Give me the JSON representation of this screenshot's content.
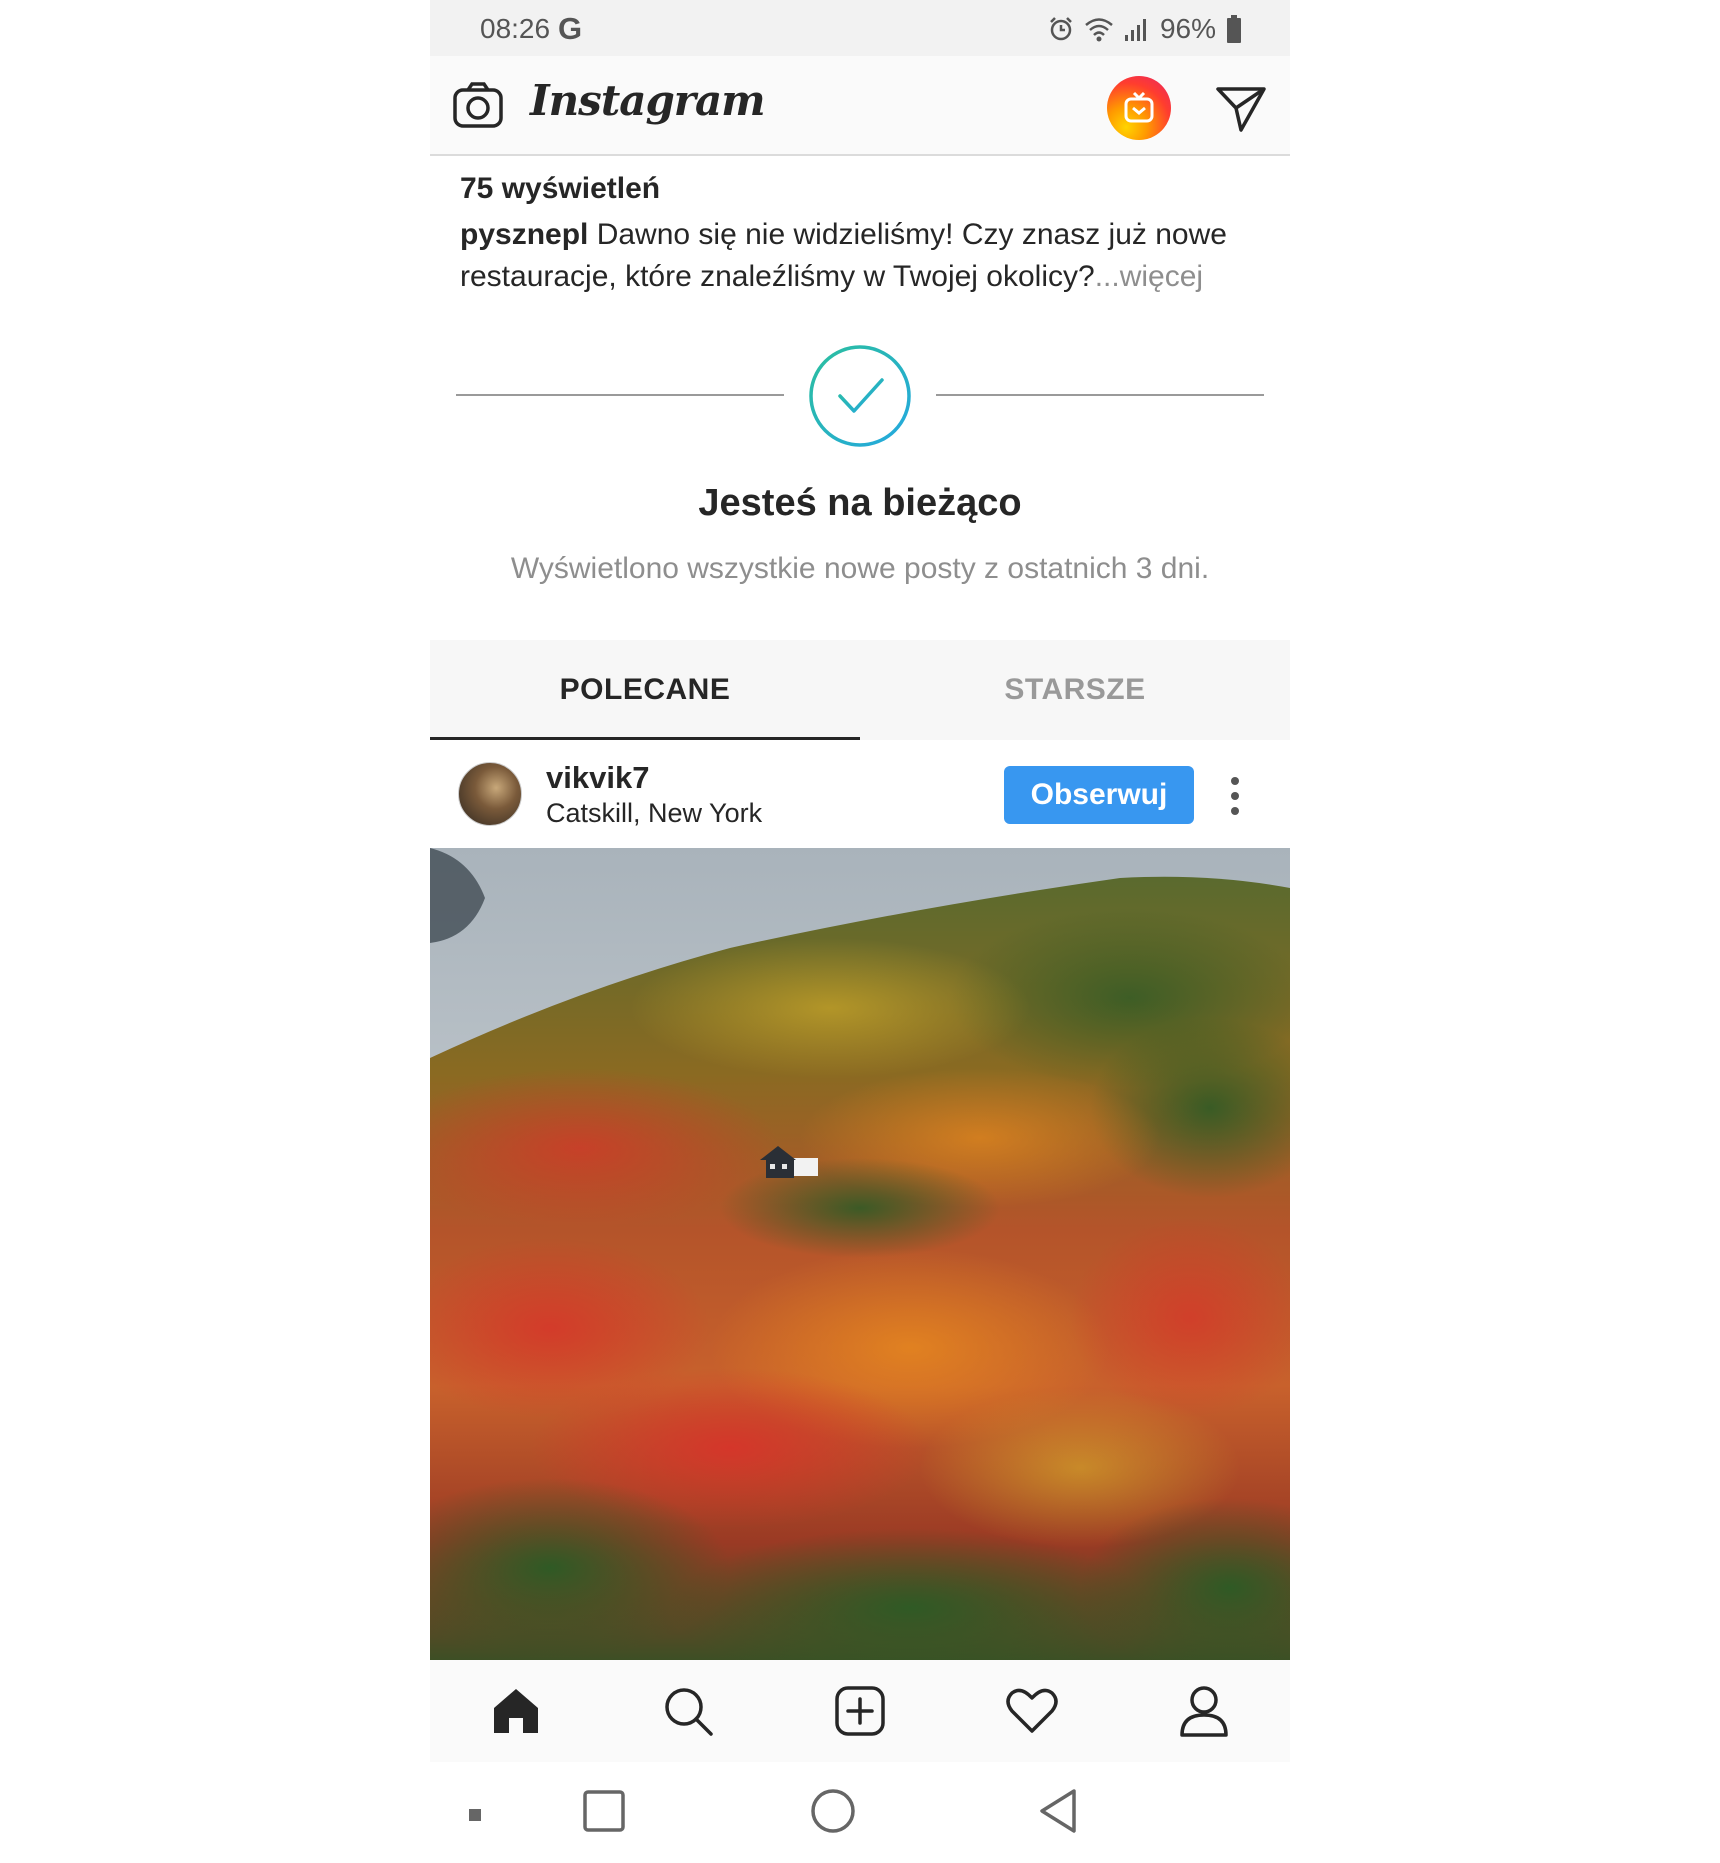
{
  "status_bar": {
    "time": "08:26",
    "google_glyph": "G",
    "battery": "96%",
    "icons": [
      "alarm-icon",
      "wifi-icon",
      "signal-icon",
      "battery-icon"
    ]
  },
  "app_header": {
    "wordmark": "Instagram",
    "icons": [
      "camera-icon",
      "igtv-icon",
      "send-icon"
    ]
  },
  "previous_post": {
    "views": "75 wyświetleń",
    "caption_user": "pysznepl",
    "caption_text": " Dawno się nie widzieliśmy! Czy znasz już nowe restauracje, które znaleźliśmy w Twojej okolicy?",
    "more_label": "...więcej"
  },
  "caught_up": {
    "title": "Jesteś na bieżąco",
    "subtitle": "Wyświetlono wszystkie nowe posty z ostatnich 3 dni."
  },
  "tabs": [
    {
      "label": "POLECANE",
      "active": true
    },
    {
      "label": "STARSZE",
      "active": false
    }
  ],
  "post": {
    "username": "vikvik7",
    "location": "Catskill, New York",
    "follow_label": "Obserwuj"
  },
  "bottom_nav": [
    "home-icon",
    "search-icon",
    "add-post-icon",
    "activity-heart-icon",
    "profile-icon"
  ],
  "system_nav": [
    "menu-dot-icon",
    "recents-icon",
    "home-circle-icon",
    "back-icon"
  ],
  "colors": {
    "follow_button": "#3897f0",
    "check_gradient_start": "#2bbf9e",
    "check_gradient_end": "#24a8e0",
    "muted_text": "#8e8e8e"
  }
}
